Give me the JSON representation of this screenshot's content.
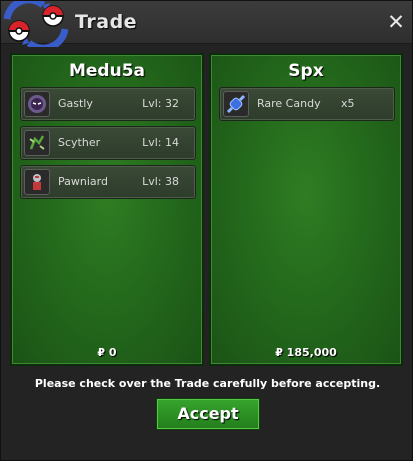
{
  "window": {
    "title": "Trade",
    "close_icon": "close-icon"
  },
  "colors": {
    "panel_green": "#246a1c",
    "button_green": "#2f9626",
    "title_bg": "#333333"
  },
  "left_panel": {
    "player": "Medu5a",
    "items": [
      {
        "name": "Gastly",
        "level": "Lvl: 32",
        "icon": "gastly-sprite-icon"
      },
      {
        "name": "Scyther",
        "level": "Lvl: 14",
        "icon": "scyther-sprite-icon"
      },
      {
        "name": "Pawniard",
        "level": "Lvl: 38",
        "icon": "pawniard-sprite-icon"
      }
    ],
    "money": "₽ 0"
  },
  "right_panel": {
    "player": "Spx",
    "items": [
      {
        "name": "Rare Candy",
        "quantity": "x5",
        "icon": "rare-candy-icon"
      }
    ],
    "money": "₽ 185,000"
  },
  "footer": {
    "notice": "Please check over the Trade carefully before accepting.",
    "accept_label": "Accept"
  }
}
